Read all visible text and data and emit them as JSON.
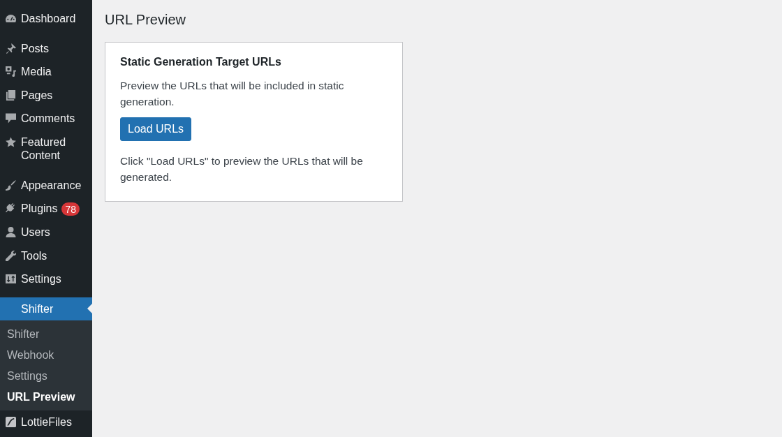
{
  "sidebar": {
    "groups": [
      {
        "items": [
          {
            "label": "Dashboard",
            "selected": false
          }
        ]
      },
      {
        "items": [
          {
            "label": "Posts",
            "selected": false
          },
          {
            "label": "Media",
            "selected": false
          },
          {
            "label": "Pages",
            "selected": false
          },
          {
            "label": "Comments",
            "selected": false
          },
          {
            "label": "Featured Content",
            "selected": false
          }
        ]
      },
      {
        "items": [
          {
            "label": "Appearance",
            "selected": false
          },
          {
            "label": "Plugins",
            "selected": false,
            "badge": "78"
          },
          {
            "label": "Users",
            "selected": false
          },
          {
            "label": "Tools",
            "selected": false
          },
          {
            "label": "Settings",
            "selected": false
          }
        ]
      },
      {
        "items": [
          {
            "label": "Shifter",
            "selected": true,
            "children": [
              {
                "label": "Shifter",
                "selected": false
              },
              {
                "label": "Webhook",
                "selected": false
              },
              {
                "label": "Settings",
                "selected": false
              },
              {
                "label": "URL Preview",
                "selected": true
              }
            ]
          },
          {
            "label": "LottieFiles",
            "selected": false
          }
        ]
      }
    ]
  },
  "page_title": "URL Preview",
  "card": {
    "title": "Static Generation Target URLs",
    "description": "Preview the URLs that will be included in static generation.",
    "button": "Load URLs",
    "hint": "Click \"Load URLs\" to preview the URLs that will be generated."
  }
}
